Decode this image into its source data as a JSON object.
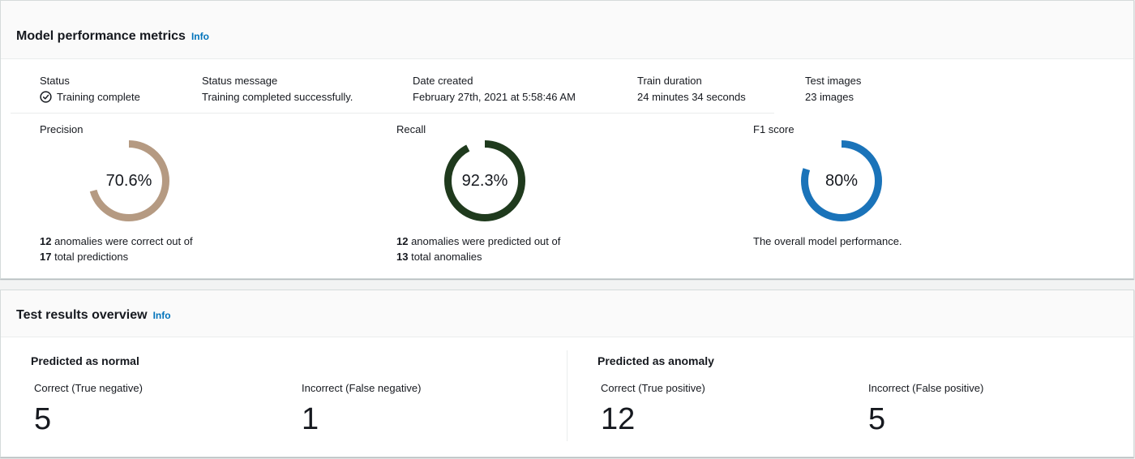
{
  "metrics_panel": {
    "title": "Model performance metrics",
    "info": "Info",
    "summary": {
      "status_label": "Status",
      "status_value": "Training complete",
      "status_icon": "check-circle-icon",
      "message_label": "Status message",
      "message_value": "Training completed successfully.",
      "date_label": "Date created",
      "date_value": "February 27th, 2021 at 5:58:46 AM",
      "duration_label": "Train duration",
      "duration_value": "24 minutes 34 seconds",
      "images_label": "Test images",
      "images_value": "23 images"
    },
    "precision": {
      "label": "Precision",
      "value_text": "70.6%",
      "fraction": 0.706,
      "color": "#b59a82",
      "count_a": "12",
      "text_a": " anomalies were correct out of",
      "count_b": "17",
      "text_b": " total predictions"
    },
    "recall": {
      "label": "Recall",
      "value_text": "92.3%",
      "fraction": 0.923,
      "color": "#1f3a1d",
      "count_a": "12",
      "text_a": " anomalies were predicted out of",
      "count_b": "13",
      "text_b": " total anomalies"
    },
    "f1": {
      "label": "F1 score",
      "value_text": "80%",
      "fraction": 0.8,
      "color": "#1a73b9",
      "desc": "The overall model performance."
    }
  },
  "results_panel": {
    "title": "Test results overview",
    "info": "Info",
    "normal": {
      "title": "Predicted as normal",
      "correct_label": "Correct (True negative)",
      "correct_value": "5",
      "incorrect_label": "Incorrect (False negative)",
      "incorrect_value": "1"
    },
    "anomaly": {
      "title": "Predicted as anomaly",
      "correct_label": "Correct (True positive)",
      "correct_value": "12",
      "incorrect_label": "Incorrect (False positive)",
      "incorrect_value": "5"
    }
  },
  "colors": {
    "accent_link": "#0073bb",
    "ring_track": "#ffffff",
    "status_text": "#16191f"
  }
}
